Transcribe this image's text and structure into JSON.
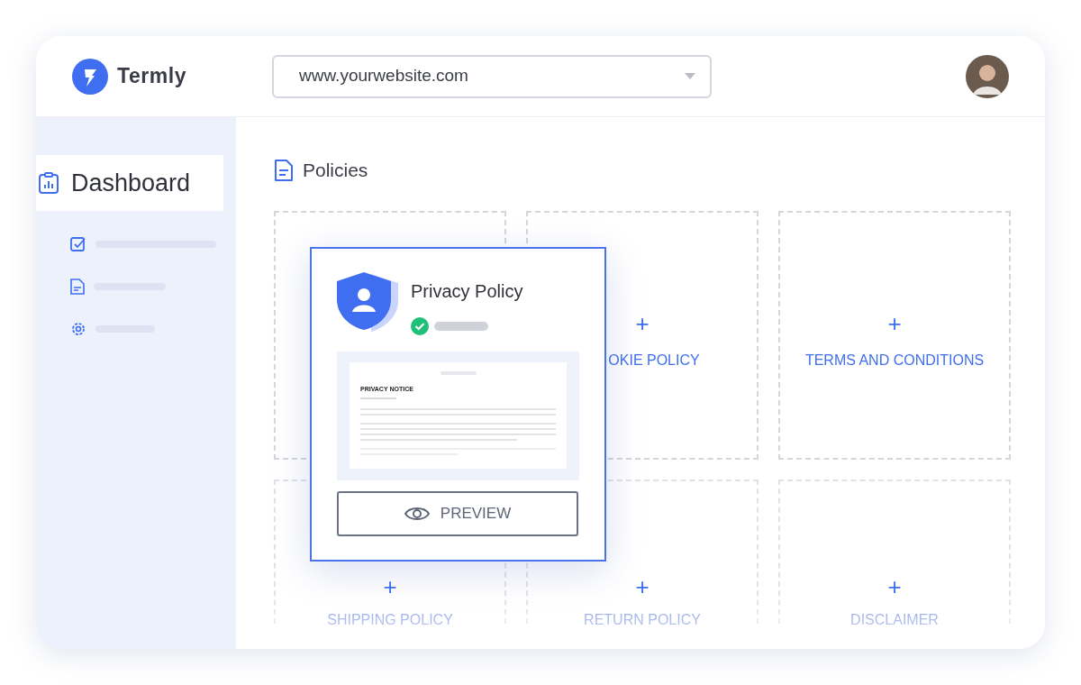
{
  "header": {
    "brand": "Termly",
    "site_select": {
      "value": "www.yourwebsite.com"
    }
  },
  "sidebar": {
    "items": [
      {
        "kind": "label",
        "label": "Dashboard",
        "selected": true
      },
      {
        "kind": "placeholder",
        "selected": false
      },
      {
        "kind": "placeholder",
        "selected": false
      },
      {
        "kind": "placeholder",
        "selected": false
      }
    ]
  },
  "main": {
    "title": "Policies",
    "cards": [
      {
        "kind": "covered"
      },
      {
        "kind": "add",
        "plus": "+",
        "label": "OKIE POLICY"
      },
      {
        "kind": "add",
        "plus": "+",
        "label": "TERMS AND CONDITIONS"
      },
      {
        "kind": "add",
        "plus": "+",
        "label": "SHIPPING POLICY"
      },
      {
        "kind": "add",
        "plus": "+",
        "label": "RETURN POLICY"
      },
      {
        "kind": "add",
        "plus": "+",
        "label": "DISCLAIMER"
      }
    ],
    "popup": {
      "title": "Privacy Policy",
      "published": true,
      "document_heading": "PRIVACY NOTICE",
      "button": "PREVIEW"
    }
  }
}
